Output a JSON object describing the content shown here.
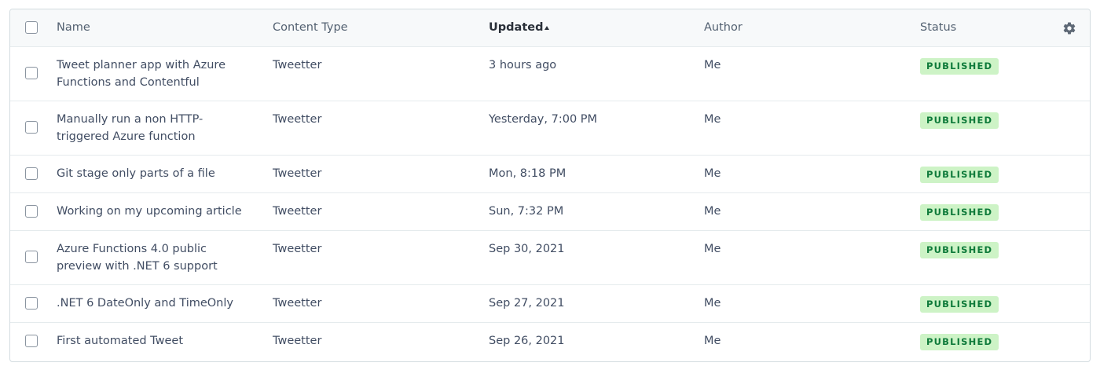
{
  "table": {
    "headers": {
      "name": "Name",
      "content_type": "Content Type",
      "updated": "Updated",
      "author": "Author",
      "status": "Status"
    },
    "sort": {
      "column": "Updated",
      "direction": "ascending"
    },
    "settings_icon": "gear-icon",
    "colors": {
      "badge_bg": "#cdf3c6",
      "badge_text": "#0e7a3a",
      "header_bg": "#f7f9fa"
    },
    "rows": [
      {
        "name": "Tweet planner app with Azure Functions and Contentful",
        "content_type": "Tweetter",
        "updated": "3 hours ago",
        "author": "Me",
        "status": "PUBLISHED"
      },
      {
        "name": "Manually run a non HTTP-triggered Azure function",
        "content_type": "Tweetter",
        "updated": "Yesterday, 7:00 PM",
        "author": "Me",
        "status": "PUBLISHED"
      },
      {
        "name": "Git stage only parts of a file",
        "content_type": "Tweetter",
        "updated": "Mon, 8:18 PM",
        "author": "Me",
        "status": "PUBLISHED"
      },
      {
        "name": "Working on my upcoming article",
        "content_type": "Tweetter",
        "updated": "Sun, 7:32 PM",
        "author": "Me",
        "status": "PUBLISHED"
      },
      {
        "name": "Azure Functions 4.0 public preview with .NET 6 support",
        "content_type": "Tweetter",
        "updated": "Sep 30, 2021",
        "author": "Me",
        "status": "PUBLISHED"
      },
      {
        "name": ".NET 6 DateOnly and TimeOnly",
        "content_type": "Tweetter",
        "updated": "Sep 27, 2021",
        "author": "Me",
        "status": "PUBLISHED"
      },
      {
        "name": "First automated Tweet",
        "content_type": "Tweetter",
        "updated": "Sep 26, 2021",
        "author": "Me",
        "status": "PUBLISHED"
      }
    ]
  }
}
